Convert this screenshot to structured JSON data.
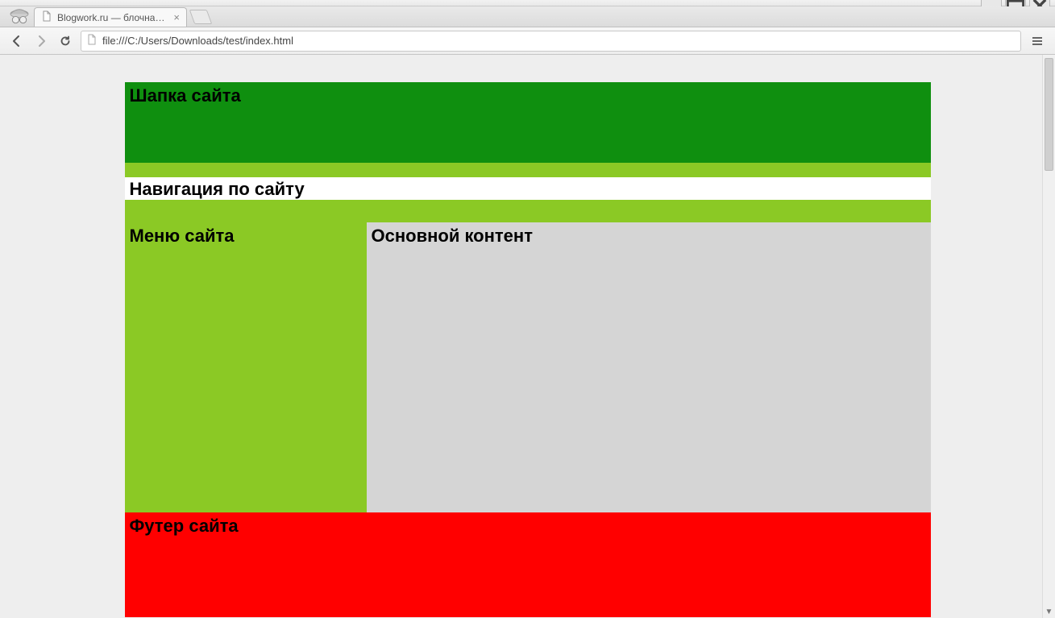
{
  "browser": {
    "tab_title": "Blogwork.ru — блочная вер",
    "url": "file:///C:/Users/Downloads/test/index.html"
  },
  "page": {
    "header": "Шапка сайта",
    "nav": "Навигация по сайту",
    "menu": "Меню сайта",
    "content": "Основной контент",
    "footer": "Футер сайта"
  }
}
